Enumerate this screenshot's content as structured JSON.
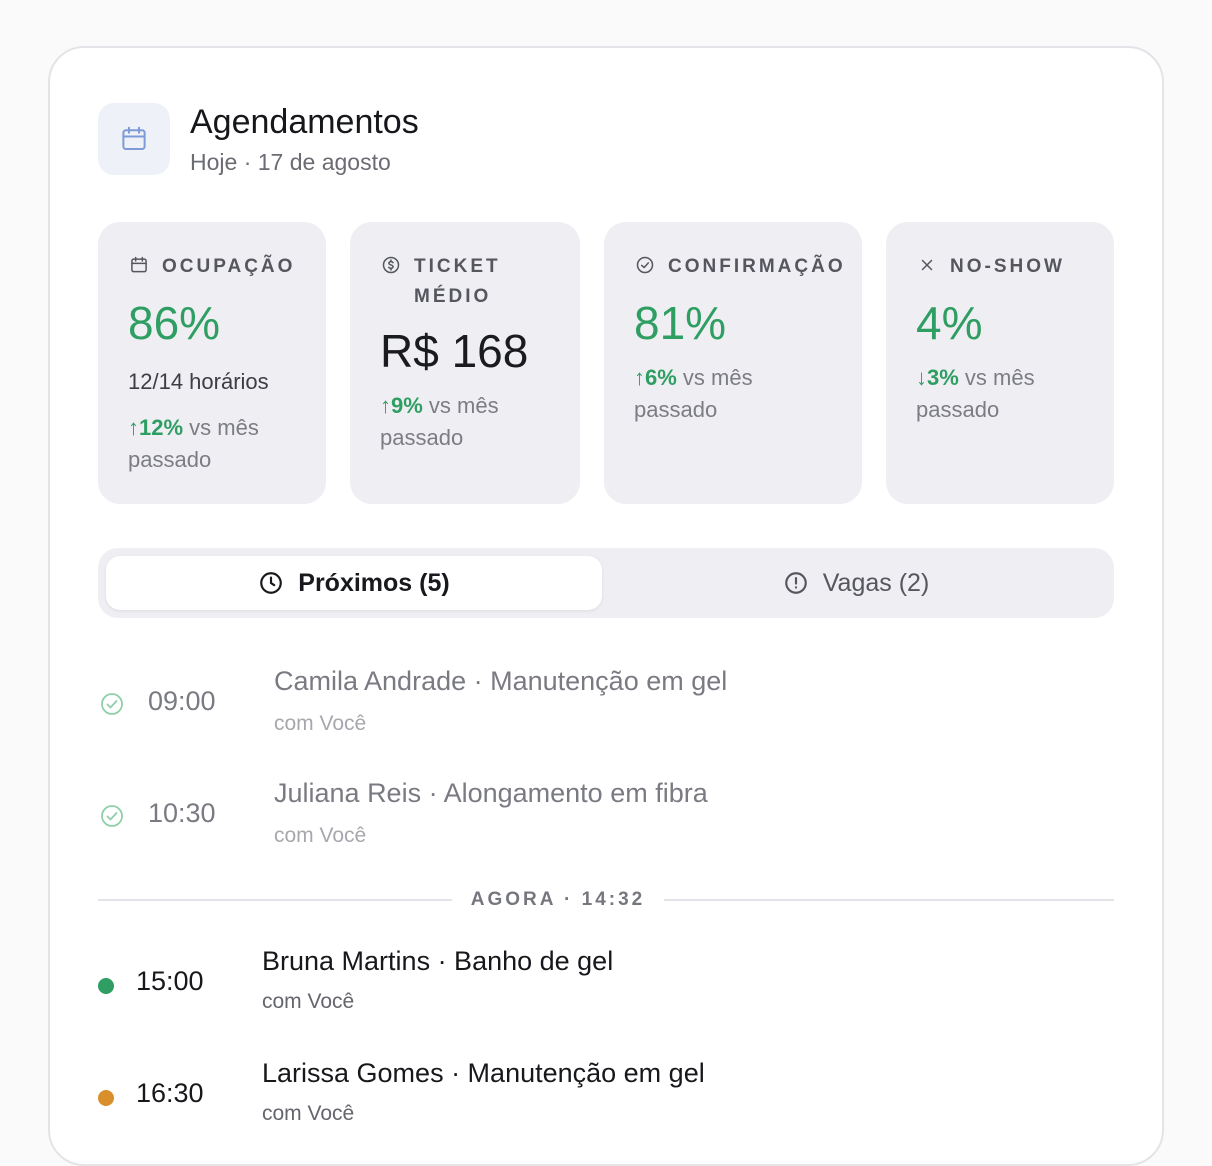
{
  "header": {
    "title": "Agendamentos",
    "subtitle": "Hoje · 17 de agosto",
    "icon": "calendar-icon"
  },
  "stats": [
    {
      "label": "OCUPAÇÃO",
      "value": "86%",
      "sub": "12/14 horários",
      "trend_value": "↑12%",
      "trend_text": " vs mês passado",
      "icon": "calendar-icon"
    },
    {
      "label": "TICKET MÉDIO",
      "value": "R$ 168",
      "trend_value": "↑9%",
      "trend_text": " vs mês passado",
      "icon": "dollar-icon"
    },
    {
      "label": "CONFIRMAÇÃO",
      "value": "81%",
      "trend_value": "↑6%",
      "trend_text": " vs mês passado",
      "icon": "check-circle-icon"
    },
    {
      "label": "NO-SHOW",
      "value": "4%",
      "trend_value": "↓3%",
      "trend_text": " vs mês passado",
      "icon": "close-icon"
    }
  ],
  "tabs": [
    {
      "label": "Próximos (5)",
      "icon": "clock-icon",
      "active": true
    },
    {
      "label": "Vagas (2)",
      "icon": "alert-circle-icon",
      "active": false
    }
  ],
  "past_appointments": [
    {
      "time": "09:00",
      "title": "Camila Andrade · Manutenção em gel",
      "with": "com Você",
      "status": "confirmed"
    },
    {
      "time": "10:30",
      "title": "Juliana Reis · Alongamento em fibra",
      "with": "com Você",
      "status": "confirmed"
    }
  ],
  "now_marker": "AGORA · 14:32",
  "upcoming_appointments": [
    {
      "time": "15:00",
      "title": "Bruna Martins · Banho de gel",
      "with": "com Você",
      "status_color": "#2f9e62"
    },
    {
      "time": "16:30",
      "title": "Larissa Gomes · Manutenção em gel",
      "with": "com Você",
      "status_color": "#d88f2c"
    }
  ],
  "colors": {
    "accent_green": "#2f9e62",
    "accent_orange": "#d88f2c",
    "icon_blue": "#7f9ad6"
  }
}
